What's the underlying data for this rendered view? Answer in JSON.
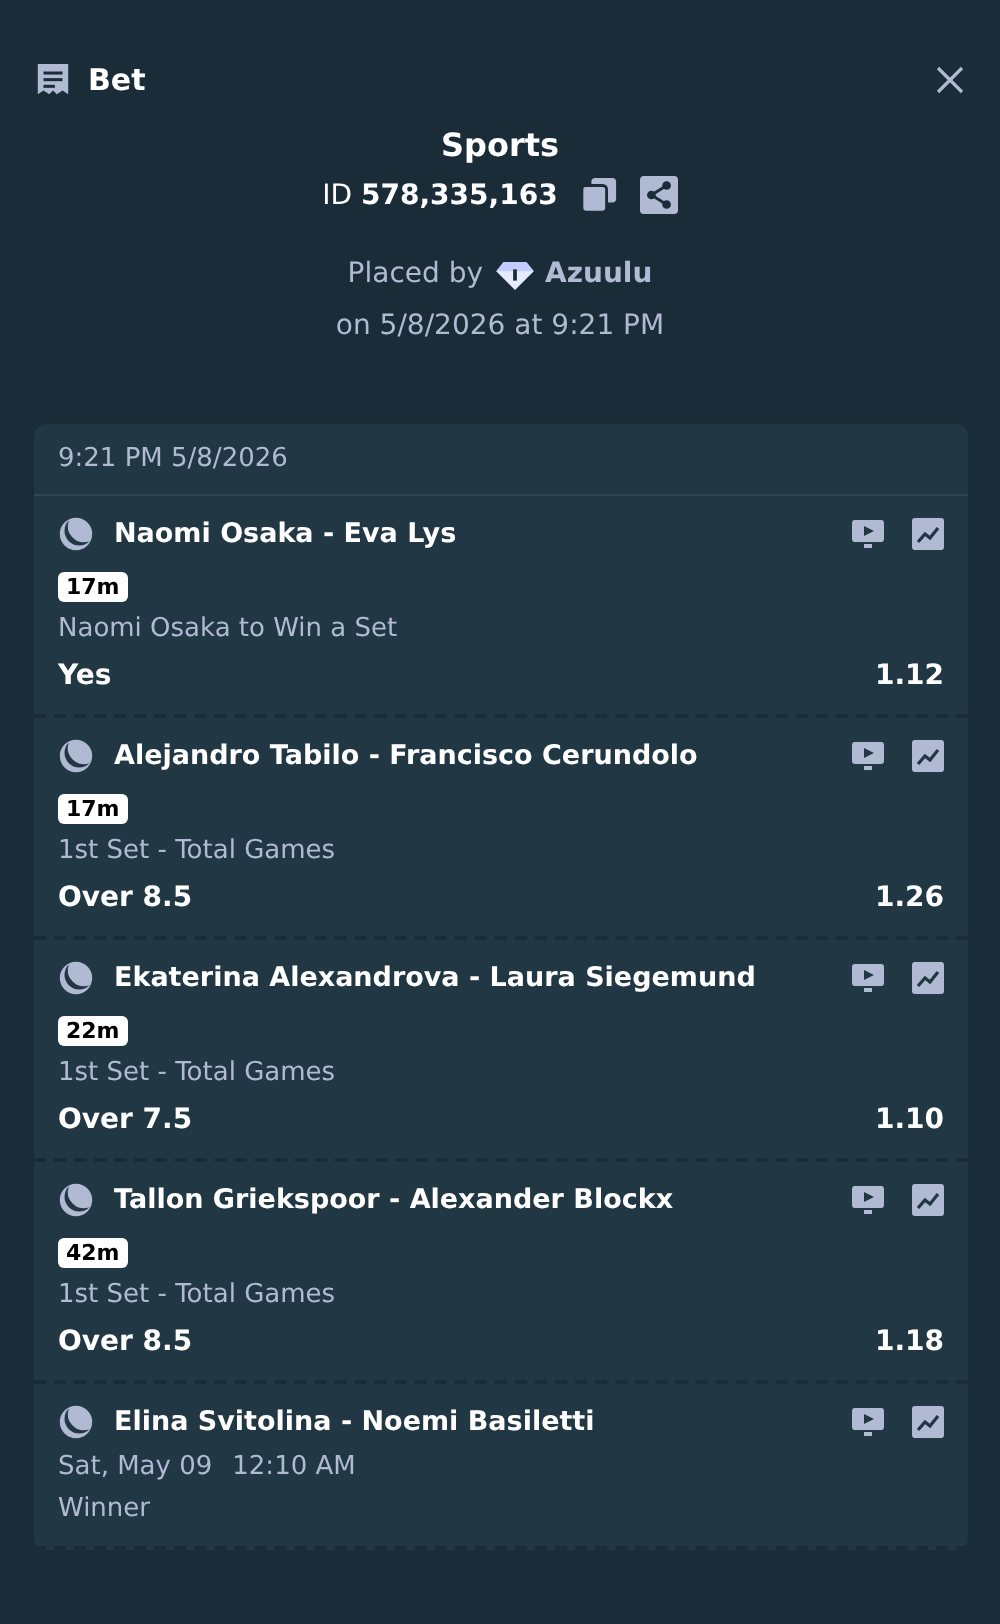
{
  "header": {
    "title": "Bet"
  },
  "summary": {
    "title": "Sports",
    "id_label": "ID",
    "id_value": "578,335,163",
    "placed_by_label": "Placed by",
    "user": "Azuulu",
    "placed_on": "on 5/8/2026 at 9:21 PM"
  },
  "slip": {
    "timestamp": "9:21 PM 5/8/2026",
    "legs": [
      {
        "kind": "live",
        "event": "Naomi Osaka - Eva Lys",
        "badge": "17m",
        "market": "Naomi Osaka to Win a Set",
        "selection": "Yes",
        "odds": "1.12"
      },
      {
        "kind": "live",
        "event": "Alejandro Tabilo - Francisco Cerundolo",
        "badge": "17m",
        "market": "1st Set - Total Games",
        "selection": "Over 8.5",
        "odds": "1.26"
      },
      {
        "kind": "live",
        "event": "Ekaterina Alexandrova - Laura Siegemund",
        "badge": "22m",
        "market": "1st Set - Total Games",
        "selection": "Over 7.5",
        "odds": "1.10"
      },
      {
        "kind": "live",
        "event": "Tallon Griekspoor - Alexander Blockx",
        "badge": "42m",
        "market": "1st Set - Total Games",
        "selection": "Over 8.5",
        "odds": "1.18"
      },
      {
        "kind": "scheduled",
        "event": "Elina Svitolina - Noemi Basiletti",
        "start_date": "Sat, May 09",
        "start_time": "12:10 AM",
        "market": "Winner"
      }
    ]
  }
}
